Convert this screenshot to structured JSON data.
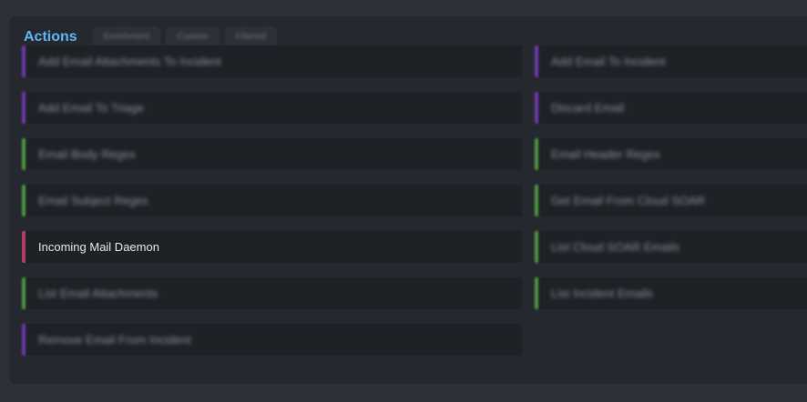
{
  "header": {
    "title": "Actions",
    "chips": [
      "Enrichment",
      "Custom",
      "Filtered"
    ]
  },
  "colors": {
    "purple": "#6f3ab0",
    "green": "#4e9a3f",
    "red": "#b33d62",
    "title": "#5eb6f2"
  },
  "actions": [
    {
      "label": "Add Email Attachments To Incident",
      "color": "purple",
      "blurred": true
    },
    {
      "label": "Add Email To Incident",
      "color": "purple",
      "blurred": true
    },
    {
      "label": "Add Email To Triage",
      "color": "purple",
      "blurred": true
    },
    {
      "label": "Discard Email",
      "color": "purple",
      "blurred": true
    },
    {
      "label": "Email Body Regex",
      "color": "green",
      "blurred": true
    },
    {
      "label": "Email Header Regex",
      "color": "green",
      "blurred": true
    },
    {
      "label": "Email Subject Regex",
      "color": "green",
      "blurred": true
    },
    {
      "label": "Get Email From Cloud SOAR",
      "color": "green",
      "blurred": true
    },
    {
      "label": "Incoming Mail Daemon",
      "color": "red",
      "blurred": false
    },
    {
      "label": "List Cloud SOAR Emails",
      "color": "green",
      "blurred": true
    },
    {
      "label": "List Email Attachments",
      "color": "green",
      "blurred": true
    },
    {
      "label": "List Incident Emails",
      "color": "green",
      "blurred": true
    },
    {
      "label": "Remove Email From Incident",
      "color": "purple",
      "blurred": true
    }
  ]
}
